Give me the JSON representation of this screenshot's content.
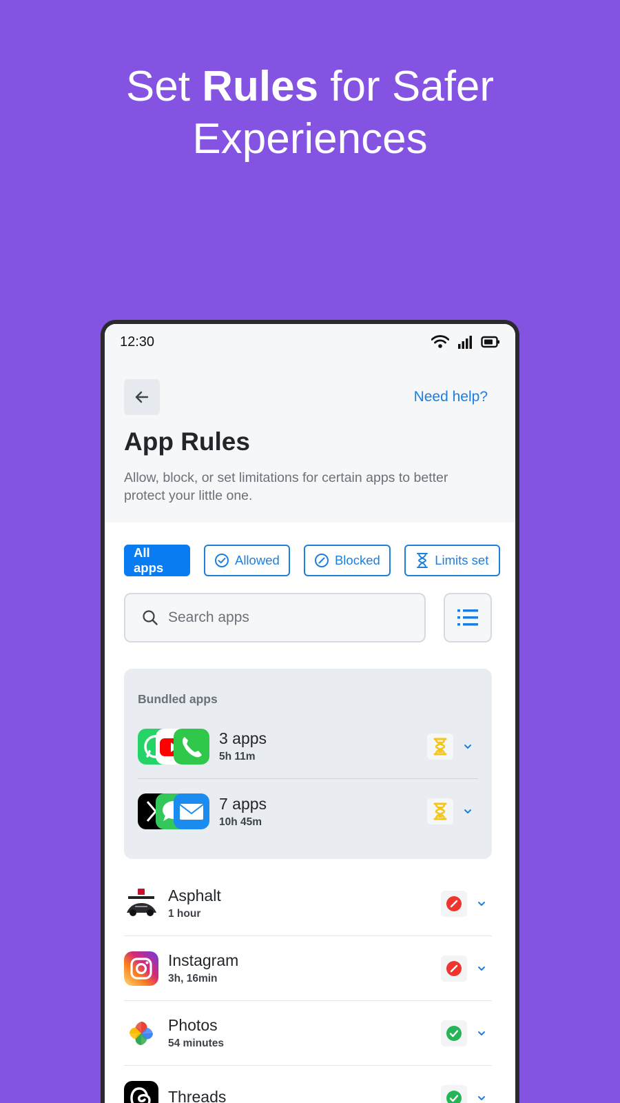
{
  "headline": {
    "before": "Set ",
    "bold": "Rules",
    "after": " for Safer",
    "line2": "Experiences"
  },
  "statusbar": {
    "time": "12:30"
  },
  "header": {
    "help_link": "Need help?",
    "title": "App Rules",
    "description": "Allow, block, or set limitations for certain apps to better protect your little one."
  },
  "filters": {
    "all": "All apps",
    "allowed": "Allowed",
    "blocked": "Blocked",
    "limits": "Limits set"
  },
  "search": {
    "placeholder": "Search apps"
  },
  "bundled": {
    "title": "Bundled apps",
    "groups": [
      {
        "name": "3 apps",
        "time": "5h 11m",
        "status": "limits-set"
      },
      {
        "name": "7 apps",
        "time": "10h 45m",
        "status": "limits-set"
      }
    ]
  },
  "apps": [
    {
      "name": "Asphalt",
      "time": "1 hour",
      "status": "blocked",
      "icon": "asphalt-icon"
    },
    {
      "name": "Instagram",
      "time": "3h, 16min",
      "status": "blocked",
      "icon": "instagram-icon"
    },
    {
      "name": "Photos",
      "time": "54 minutes",
      "status": "allowed",
      "icon": "photos-icon"
    },
    {
      "name": "Threads",
      "time": "",
      "status": "allowed",
      "icon": "threads-icon"
    }
  ],
  "colors": {
    "background": "#8453E1",
    "accent": "#0A7CF2",
    "blocked": "#F0342E",
    "allowed": "#27B456",
    "limit": "#F5C518"
  }
}
